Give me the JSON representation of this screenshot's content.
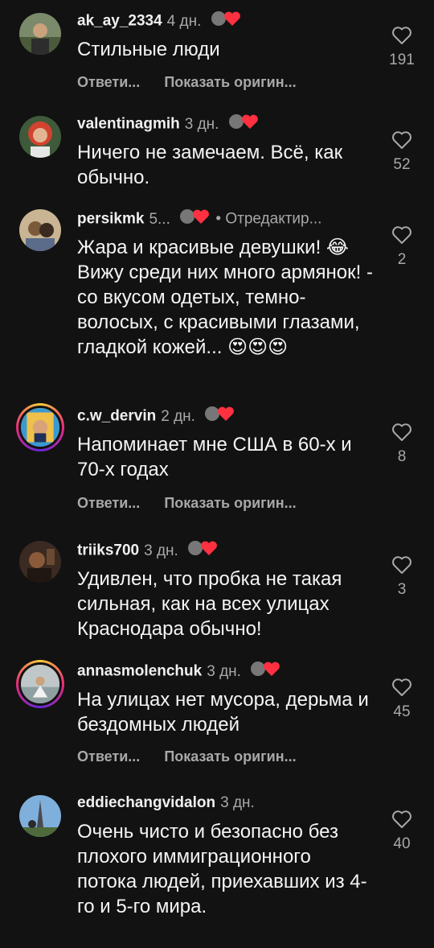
{
  "comments": [
    {
      "user": "ak_ay_2334",
      "time": "4 дн.",
      "text": "Стильные люди",
      "reply": "Ответи...",
      "translate": "Показать оригин...",
      "likes": "191"
    },
    {
      "user": "valentinagmih",
      "time": "3 дн.",
      "text": "Ничего не замечаем. Всё, как обычно.",
      "likes": "52"
    },
    {
      "user": "persikmk",
      "time": "5...",
      "edited": "• Отредактир...",
      "text": "Жара и красивые девушки! 😂 Вижу среди них много армянок! - со вкусом одетых, темно-волосых, с красивыми глазами, гладкой кожей... 😍😍😍",
      "likes": "2"
    },
    {
      "user": "c.w_dervin",
      "time": "2 дн.",
      "text": "Напоминает мне США в 60-х и 70-х годах",
      "reply": "Ответи...",
      "translate": "Показать оригин...",
      "likes": "8"
    },
    {
      "user": "triiks700",
      "time": "3 дн.",
      "text": "Удивлен, что пробка не такая сильная, как на всех улицах Краснодара обычно!",
      "likes": "3"
    },
    {
      "user": "annasmolenchuk",
      "time": "3 дн.",
      "text": "На улицах нет мусора, дерьма и бездомных людей",
      "reply": "Ответи...",
      "translate": "Показать оригин...",
      "likes": "45"
    },
    {
      "user": "eddiechangvidalon",
      "time": "3 дн.",
      "text": "Очень чисто и безопасно без плохого иммиграционного потока людей, приехавших из 4-го и 5-го мира.",
      "likes": "40"
    }
  ],
  "icons": {
    "like": "heart-outline-icon",
    "author_like": "author-liked-heart-icon"
  },
  "colors": {
    "background": "#121212",
    "secondary_text": "#a8a8a8",
    "author_heart": "#ff3040"
  }
}
